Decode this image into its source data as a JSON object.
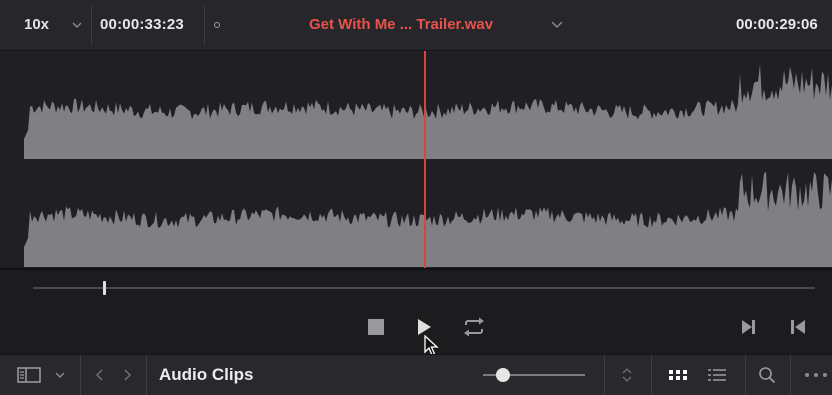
{
  "toolbar": {
    "zoom_value": "10x",
    "timecode_position": "00:00:33:23",
    "clip_name": "Get With Me ... Trailer.wav",
    "timecode_duration": "00:00:29:06"
  },
  "colors": {
    "accent_red": "#e8524d",
    "playhead": "#d9433f",
    "waveform": "#808083",
    "background": "#1f1f24"
  },
  "transport": {
    "buttons": [
      "stop-icon",
      "play-icon",
      "loop-icon",
      "next-frame-icon",
      "previous-frame-icon"
    ]
  },
  "bottom": {
    "section_title": "Audio Clips",
    "icons": [
      "panel-toggle-icon",
      "chevron-down-icon",
      "back-icon",
      "forward-icon",
      "zoom-slider",
      "sort-icon",
      "grid-view-icon",
      "list-view-icon",
      "search-icon",
      "more-icon"
    ],
    "zoom_slider_level": 0.2
  }
}
